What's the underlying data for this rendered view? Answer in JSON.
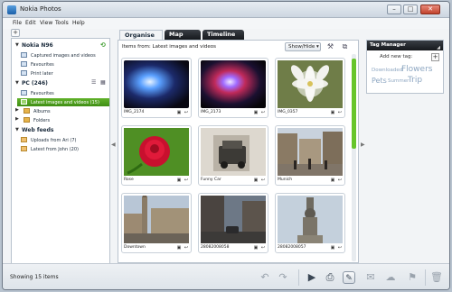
{
  "window": {
    "title": "Nokia Photos",
    "min_label": "–",
    "max_label": "□",
    "close_label": "✕"
  },
  "menu": [
    "File",
    "Edit",
    "View",
    "Tools",
    "Help"
  ],
  "left_panel": {
    "add_label": "+",
    "device": {
      "name": "Nokia N96",
      "items": [
        "Captured images and videos",
        "Favourites",
        "Print later"
      ]
    },
    "pc": {
      "name": "PC (246)",
      "items": [
        "Favourites",
        "Latest images and videos (15)",
        "Albums",
        "Folders"
      ]
    },
    "web": {
      "name": "Web feeds",
      "items": [
        "Uploads from Ari (7)",
        "Latest from John (20)"
      ]
    }
  },
  "tabs": [
    "Organise",
    "Map",
    "Timeline"
  ],
  "center": {
    "items_from": "Items from: Latest images and videos",
    "show_hide": "Show/Hide ▾",
    "thumbnails": [
      {
        "caption": "IMG_2174"
      },
      {
        "caption": "IMG_2173"
      },
      {
        "caption": "IMG_0357"
      },
      {
        "caption": "Rose"
      },
      {
        "caption": "Funny Car"
      },
      {
        "caption": "Munich"
      },
      {
        "caption": "Downtown"
      },
      {
        "caption": "28082008058"
      },
      {
        "caption": "28082008057"
      }
    ]
  },
  "tag_manager": {
    "title": "Tag Manager",
    "add_placeholder": "Add new tag:",
    "add_btn": "+",
    "tags": [
      "Downloaded",
      "Flowers",
      "Pets",
      "Summer",
      "Trip"
    ]
  },
  "status": {
    "text": "Showing 15 items"
  },
  "colors": {
    "accent_green": "#5aa822",
    "dark_tab": "#1e2226",
    "tag_blue": "#8ea7c2"
  }
}
